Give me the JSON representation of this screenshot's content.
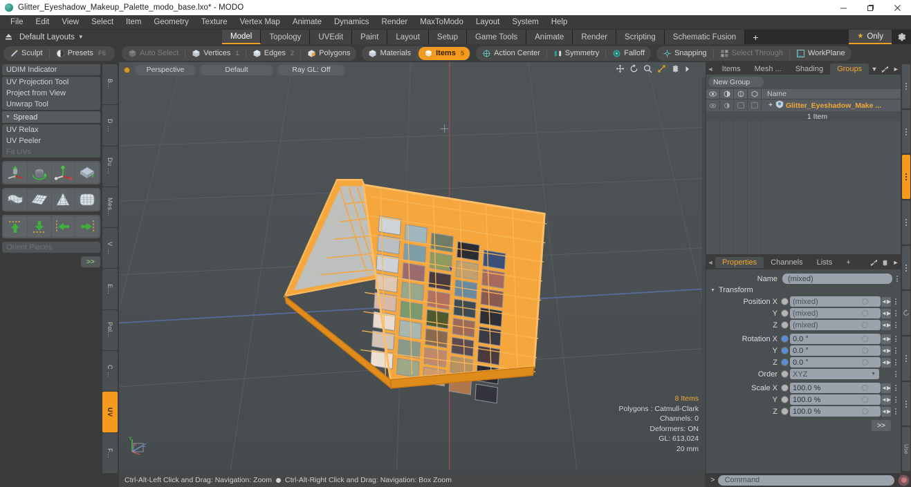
{
  "window": {
    "title": "Glitter_Eyeshadow_Makeup_Palette_modo_base.lxo* - MODO",
    "app_icon": "modo-logo-icon",
    "controls": {
      "minimize": "minimize-icon",
      "maximize": "maximize-icon",
      "close": "close-icon"
    }
  },
  "menubar": {
    "items": [
      "File",
      "Edit",
      "View",
      "Select",
      "Item",
      "Geometry",
      "Texture",
      "Vertex Map",
      "Animate",
      "Dynamics",
      "Render",
      "MaxToModo",
      "Layout",
      "System",
      "Help"
    ]
  },
  "layoutbar": {
    "layout_name": "Default Layouts",
    "tabs": [
      {
        "label": "Model",
        "active": true
      },
      {
        "label": "Topology",
        "active": false
      },
      {
        "label": "UVEdit",
        "active": false
      },
      {
        "label": "Paint",
        "active": false
      },
      {
        "label": "Layout",
        "active": false
      },
      {
        "label": "Setup",
        "active": false
      },
      {
        "label": "Game Tools",
        "active": false
      },
      {
        "label": "Animate",
        "active": false
      },
      {
        "label": "Render",
        "active": false
      },
      {
        "label": "Scripting",
        "active": false
      },
      {
        "label": "Schematic Fusion",
        "active": false
      }
    ],
    "add_tab": "+",
    "only_label": "Only",
    "gear": "gear-icon"
  },
  "modebar": {
    "left_group": [
      {
        "label": "Sculpt",
        "icon": "brush-icon",
        "active": false,
        "dim": false
      },
      {
        "label": "Presets",
        "icon": "presets-icon",
        "active": false,
        "dim": false,
        "shortcut": "F6"
      }
    ],
    "select_group": [
      {
        "label": "Auto Select",
        "icon": "cube-icon",
        "active": false,
        "dim": true,
        "num": ""
      },
      {
        "label": "Vertices",
        "icon": "cube-icon",
        "active": false,
        "dim": false,
        "num": "1"
      },
      {
        "label": "Edges",
        "icon": "cube-icon",
        "active": false,
        "dim": false,
        "num": "2"
      },
      {
        "label": "Polygons",
        "icon": "cube-icon",
        "active": false,
        "dim": false,
        "num": ""
      }
    ],
    "items_group": [
      {
        "label": "Materials",
        "icon": "cube-icon",
        "active": false,
        "dim": false,
        "num": ""
      },
      {
        "label": "Items",
        "icon": "cube-icon",
        "active": true,
        "dim": false,
        "num": "5"
      }
    ],
    "tools_group": [
      {
        "label": "Action Center",
        "icon": "action-center-icon",
        "active": false,
        "dim": false
      },
      {
        "label": "Symmetry",
        "icon": "symmetry-icon",
        "active": false,
        "dim": false
      },
      {
        "label": "Falloff",
        "icon": "falloff-icon",
        "active": false,
        "dim": false
      }
    ],
    "snap_group": [
      {
        "label": "Snapping",
        "icon": "snapping-icon",
        "active": false,
        "dim": false
      },
      {
        "label": "Select Through",
        "icon": "select-through-icon",
        "active": false,
        "dim": true
      },
      {
        "label": "WorkPlane",
        "icon": "workplane-icon",
        "active": false,
        "dim": false
      }
    ]
  },
  "left_panel": {
    "buttons_top": [
      {
        "label": "UDIM Indicator",
        "dim": false
      }
    ],
    "group_a": [
      {
        "label": "UV Projection Tool",
        "dim": false
      },
      {
        "label": "Project from View",
        "dim": false
      },
      {
        "label": "Unwrap Tool",
        "dim": false
      }
    ],
    "section": {
      "label": "Spread",
      "expanded": true
    },
    "group_b": [
      {
        "label": "UV Relax",
        "dim": false
      },
      {
        "label": "UV Peeler",
        "dim": false
      },
      {
        "label": "Fit UVs",
        "dim": true
      }
    ],
    "icon_rows": [
      [
        "uv-move-icon",
        "uv-rotate-icon",
        "uv-scale-icon",
        "uv-flip-icon"
      ],
      [
        "uv-drape-icon",
        "uv-grid-flat-icon",
        "uv-cone-icon",
        "uv-sphere-grid-icon"
      ],
      [
        "align-up-icon",
        "align-down-icon",
        "align-left-icon",
        "align-right-icon"
      ]
    ],
    "orient_field": {
      "label": "Orient Pieces",
      "dim": true
    },
    "more_label": ">>",
    "vertical_tabs": [
      {
        "label": "B...",
        "active": false
      },
      {
        "label": "D ...",
        "active": false
      },
      {
        "label": "Du ...",
        "active": false
      },
      {
        "label": "Mes...",
        "active": false
      },
      {
        "label": "V ...",
        "active": false
      },
      {
        "label": "E...",
        "active": false
      },
      {
        "label": "Pol...",
        "active": false
      },
      {
        "label": "C ...",
        "active": false
      },
      {
        "label": "UV",
        "active": true
      },
      {
        "label": "F...",
        "active": false
      }
    ]
  },
  "viewport": {
    "view_mode": "Perspective",
    "shading_mode": "Default",
    "raygl": "Ray GL: Off",
    "tools": [
      "pan-icon",
      "rotate-icon",
      "zoom-icon",
      "fit-icon",
      "gear-icon",
      "chevron-right-icon"
    ],
    "info": {
      "items": "8 Items",
      "polygons": "Polygons : Catmull-Clark",
      "channels": "Channels: 0",
      "deformers": "Deformers: ON",
      "gl": "GL: 613,024",
      "grid": "20 mm"
    },
    "axis_gizmo": {
      "x": "X",
      "y": "Y",
      "z": "Z"
    }
  },
  "right_panel": {
    "top_tabs": [
      {
        "label": "Items",
        "active": false
      },
      {
        "label": "Mesh ...",
        "active": false
      },
      {
        "label": "Shading",
        "active": false
      },
      {
        "label": "Groups",
        "active": true
      }
    ],
    "groups": {
      "new_group_button": "New Group",
      "columns": [
        "eye-icon",
        "lock-icon",
        "render-icon",
        "select-icon",
        "Name"
      ],
      "rows": [
        {
          "name": "Glitter_Eyeshadow_Make ...",
          "sub": "1 Item",
          "icon": "group-shield-icon"
        }
      ]
    },
    "bottom_tabs": [
      {
        "label": "Properties",
        "active": true
      },
      {
        "label": "Channels",
        "active": false
      },
      {
        "label": "Lists",
        "active": false
      },
      {
        "label": "+",
        "active": false
      }
    ],
    "properties": {
      "name_label": "Name",
      "name_value": "(mixed)",
      "transform_section": "Transform",
      "rows": [
        {
          "label": "Position X",
          "value": "(mixed)",
          "radio": "gray",
          "type": "field"
        },
        {
          "label": "Y",
          "value": "(mixed)",
          "radio": "gray",
          "type": "field"
        },
        {
          "label": "Z",
          "value": "(mixed)",
          "radio": "gray",
          "type": "field"
        },
        {
          "label": "Rotation X",
          "value": "0.0 °",
          "radio": "blue",
          "type": "field"
        },
        {
          "label": "Y",
          "value": "0.0 °",
          "radio": "blue",
          "type": "field"
        },
        {
          "label": "Z",
          "value": "0.0 °",
          "radio": "blue",
          "type": "field"
        },
        {
          "label": "Order",
          "value": "XYZ",
          "radio": "gray",
          "type": "select"
        },
        {
          "label": "Scale X",
          "value": "100.0 %",
          "radio": "gray",
          "type": "field"
        },
        {
          "label": "Y",
          "value": "100.0 %",
          "radio": "gray",
          "type": "field"
        },
        {
          "label": "Z",
          "value": "100.0 %",
          "radio": "gray",
          "type": "field"
        }
      ],
      "more_label": ">>"
    }
  },
  "statusbar": {
    "text_left": "Ctrl-Alt-Left Click and Drag: Navigation: Zoom",
    "text_right": "Ctrl-Alt-Right Click and Drag: Navigation: Box Zoom"
  },
  "command": {
    "prompt": ">",
    "placeholder": "Command",
    "record_button": "record-icon"
  },
  "colors": {
    "accent_orange": "#f49a1e",
    "selection_orange": "#f5a63c",
    "panel_bg": "#4a4f52",
    "app_bg": "#3b3b3b",
    "field_bg": "#9aa3ab"
  }
}
